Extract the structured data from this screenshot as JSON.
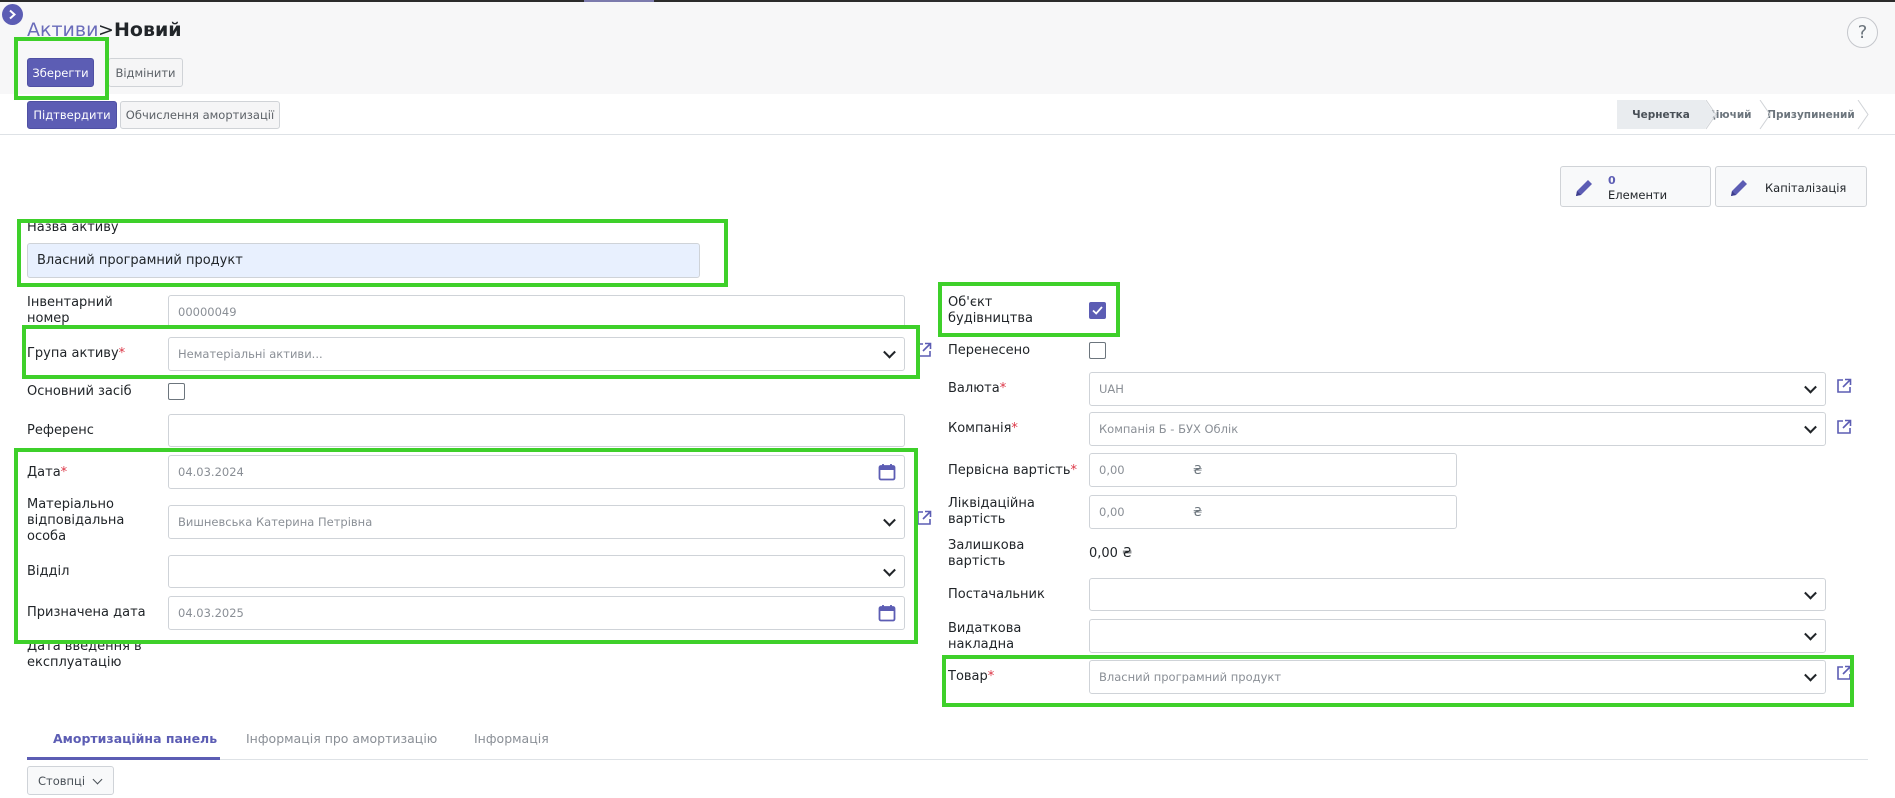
{
  "breadcrumb": {
    "root": "Активи",
    "separator": ">",
    "current": "Новий"
  },
  "help_label": "?",
  "toolbar": {
    "save_label": "Зберегти",
    "discard_label": "Відмінити"
  },
  "actions": {
    "confirm_label": "Підтвердити",
    "compute_depreciation_label": "Обчислення амортизації"
  },
  "statusbar": {
    "items": [
      "Чернетка",
      "Діючий",
      "Призупинений"
    ],
    "active_index": 0
  },
  "smart_buttons": {
    "items": {
      "count": "0",
      "label": "Елементи"
    },
    "capitalization": {
      "label": "Капіталізація"
    }
  },
  "form": {
    "name_label": "Назва активу",
    "name_value": "Власний програмний продукт",
    "inventory_label": "Інвентарний номер",
    "inventory_value": "00000049",
    "group_label": "Група активу",
    "group_value": "Нематеріальні активи...",
    "main_asset_label": "Основний засіб",
    "main_asset_checked": false,
    "reference_label": "Референс",
    "reference_value": "",
    "date_label": "Дата",
    "date_value": "04.03.2024",
    "responsible_label": "Матеріально відповідальна особа",
    "responsible_value": "Вишневська Катерина Петрівна",
    "department_label": "Відділ",
    "department_value": "",
    "assigned_date_label": "Призначена дата",
    "assigned_date_value": "04.03.2025",
    "commissioning_label": "Дата введення в експлуатацію",
    "construction_label": "Об'єкт будівництва",
    "construction_checked": true,
    "transferred_label": "Перенесено",
    "transferred_checked": false,
    "currency_label": "Валюта",
    "currency_value": "UAH",
    "company_label": "Компанія",
    "company_value": "Компанія Б - БУХ Облік",
    "initial_value_label": "Первісна вартість",
    "initial_value_value": "0,00",
    "liquidation_label": "Ліквідаційна вартість",
    "liquidation_value": "0,00",
    "residual_label": "Залишкова вартість",
    "residual_value": "0,00 ₴",
    "currency_symbol": "₴",
    "supplier_label": "Постачальник",
    "supplier_value": "",
    "invoice_label": "Видаткова накладна",
    "invoice_value": "",
    "product_label": "Товар",
    "product_value": "Власний програмний продукт",
    "required_mark": "*"
  },
  "tabs": [
    "Амортизаційна панель",
    "Інформація про амортизацію",
    "Інформація"
  ],
  "columns_button": "Стовпці",
  "colors": {
    "primary": "#5c5db4",
    "highlight_border": "#3ed02a",
    "required": "#dc3545"
  }
}
